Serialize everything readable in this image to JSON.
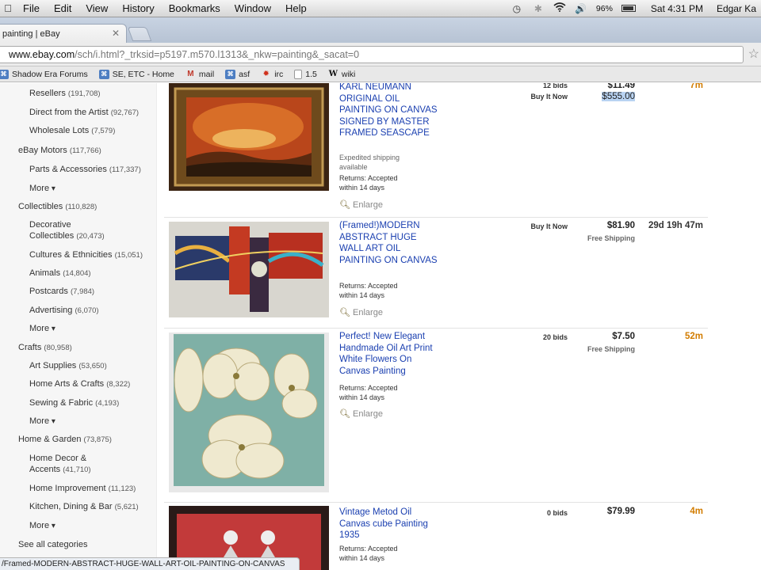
{
  "menubar": {
    "items": [
      "File",
      "Edit",
      "View",
      "History",
      "Bookmarks",
      "Window",
      "Help"
    ],
    "battery": "96%",
    "clock": "Sat 4:31 PM",
    "user": "Edgar Ka"
  },
  "tab": {
    "title": "painting | eBay"
  },
  "address": {
    "host": "www.ebay.com",
    "path": "/sch/i.html?_trksid=p5197.m570.l1313&_nkw=painting&_sacat=0"
  },
  "bookmarks": [
    {
      "label": "Shadow Era Forums",
      "icon": "puzzle-icon"
    },
    {
      "label": "SE, ETC - Home",
      "icon": "puzzle-icon"
    },
    {
      "label": "mail",
      "icon": "gmail-icon"
    },
    {
      "label": "asf",
      "icon": "puzzle-icon"
    },
    {
      "label": "irc",
      "icon": "spark-icon"
    },
    {
      "label": "1.5",
      "icon": "page-icon"
    },
    {
      "label": "wiki",
      "icon": "wikipedia-icon"
    }
  ],
  "sidebar": {
    "items": [
      {
        "label": "Resellers",
        "count": "(191,708)"
      },
      {
        "label": "Direct from the Artist",
        "count": "(92,767)"
      },
      {
        "label": "Wholesale Lots",
        "count": "(7,579)"
      },
      {
        "label": "eBay Motors",
        "count": "(117,766)"
      },
      {
        "label": "Parts & Accessories",
        "count": "(117,337)"
      },
      {
        "label": "More"
      },
      {
        "label": "Collectibles",
        "count": "(110,828)"
      },
      {
        "label": "Decorative",
        "label2": "Collectibles",
        "count": "(20,473)"
      },
      {
        "label": "Cultures & Ethnicities",
        "count": "(15,051)"
      },
      {
        "label": "Animals",
        "count": "(14,804)"
      },
      {
        "label": "Postcards",
        "count": "(7,984)"
      },
      {
        "label": "Advertising",
        "count": "(6,070)"
      },
      {
        "label": "More"
      },
      {
        "label": "Crafts",
        "count": "(80,958)"
      },
      {
        "label": "Art Supplies",
        "count": "(53,650)"
      },
      {
        "label": "Home Arts & Crafts",
        "count": "(8,322)"
      },
      {
        "label": "Sewing & Fabric",
        "count": "(4,193)"
      },
      {
        "label": "More"
      },
      {
        "label": "Home & Garden",
        "count": "(73,875)"
      },
      {
        "label": "Home Decor &",
        "label2": "Accents",
        "count": "(41,710)"
      },
      {
        "label": "Home Improvement",
        "count": "(11,123)"
      },
      {
        "label": "Kitchen, Dining & Bar",
        "count": "(5,621)"
      },
      {
        "label": "More"
      },
      {
        "label": "See all categories"
      }
    ]
  },
  "listings": [
    {
      "title": "KARL NEUMANN ORIGINAL OIL PAINTING ON CANVAS SIGNED BY MASTER FRAMED SEASCAPE",
      "bids": "12 bids",
      "buy_it_now": "Buy It Now",
      "price": "$11.49",
      "bin_price": "$555.00",
      "time_left": "7m",
      "shipping_note": "Expedited shipping available",
      "returns": "Returns: Accepted",
      "returns2": "within 14 days",
      "enlarge": "Enlarge"
    },
    {
      "title": "(Framed!)MODERN ABSTRACT HUGE WALL ART OIL PAINTING ON CANVAS",
      "bids": "Buy It Now",
      "price": "$81.90",
      "shipping": "Free Shipping",
      "time_left": "29d 19h 47m",
      "returns": "Returns: Accepted",
      "returns2": "within 14 days",
      "enlarge": "Enlarge"
    },
    {
      "title": "Perfect! New Elegant Handmade Oil Art Print White Flowers On Canvas Painting",
      "bids": "20 bids",
      "price": "$7.50",
      "shipping": "Free Shipping",
      "time_left": "52m",
      "returns": "Returns: Accepted",
      "returns2": "within 14 days",
      "enlarge": "Enlarge"
    },
    {
      "title": "Vintage Metod Oil Canvas cube Painting 1935",
      "bids": "0 bids",
      "price": "$79.99",
      "time_left": "4m",
      "returns": "Returns: Accepted",
      "returns2": "within 14 days"
    }
  ],
  "status_url": "/Framed-MODERN-ABSTRACT-HUGE-WALL-ART-OIL-PAINTING-ON-CANVAS",
  "colors": {
    "link": "#1a3fb0",
    "timeleft_orange": "#d27c00",
    "highlight": "#b9d3f2"
  }
}
